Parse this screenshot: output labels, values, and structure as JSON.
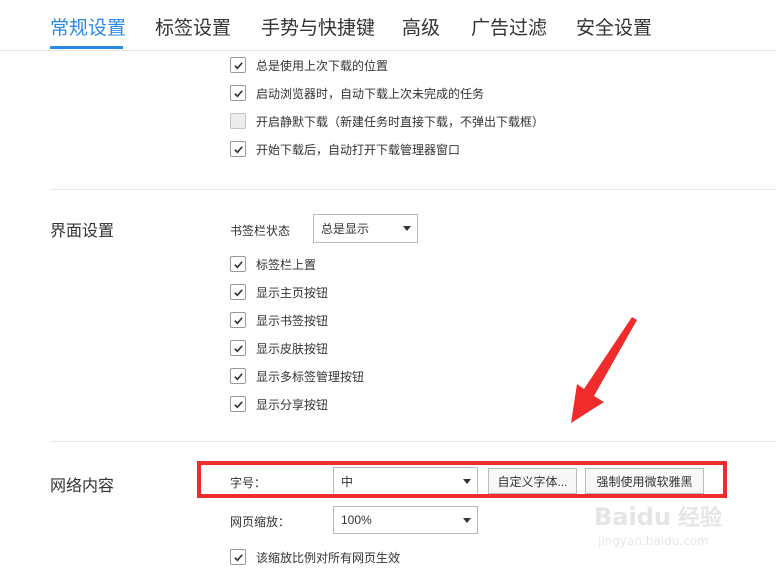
{
  "tabs": [
    {
      "label": "常规设置",
      "active": true
    },
    {
      "label": "标签设置",
      "active": false
    },
    {
      "label": "手势与快捷键",
      "active": false
    },
    {
      "label": "高级",
      "active": false
    },
    {
      "label": "广告过滤",
      "active": false
    },
    {
      "label": "安全设置",
      "active": false
    }
  ],
  "download": {
    "options": [
      {
        "label": "总是使用上次下载的位置",
        "checked": true
      },
      {
        "label": "启动浏览器时，自动下载上次未完成的任务",
        "checked": true
      },
      {
        "label": "开启静默下载（新建任务时直接下载，不弹出下载框）",
        "checked": false
      },
      {
        "label": "开始下载后，自动打开下载管理器窗口",
        "checked": true
      }
    ]
  },
  "interface": {
    "title": "界面设置",
    "bookmark_bar_label": "书签栏状态",
    "bookmark_bar_value": "总是显示",
    "options": [
      {
        "label": "标签栏上置",
        "checked": true
      },
      {
        "label": "显示主页按钮",
        "checked": true
      },
      {
        "label": "显示书签按钮",
        "checked": true
      },
      {
        "label": "显示皮肤按钮",
        "checked": true
      },
      {
        "label": "显示多标签管理按钮",
        "checked": true
      },
      {
        "label": "显示分享按钮",
        "checked": true
      }
    ]
  },
  "web_content": {
    "title": "网络内容",
    "font_size_label": "字号：",
    "font_size_value": "中",
    "custom_font_button": "自定义字体...",
    "force_yahei_button": "强制使用微软雅黑",
    "zoom_label": "网页缩放：",
    "zoom_value": "100%",
    "zoom_all_option": {
      "label": "该缩放比例对所有网页生效",
      "checked": true
    }
  },
  "annotation": {
    "highlight_color": "#ef2b2b",
    "accent_color": "#2a8ae6"
  },
  "watermark": {
    "brand": "Baidu",
    "brand_cn": "经验",
    "url": "jingyan.baidu.com"
  }
}
